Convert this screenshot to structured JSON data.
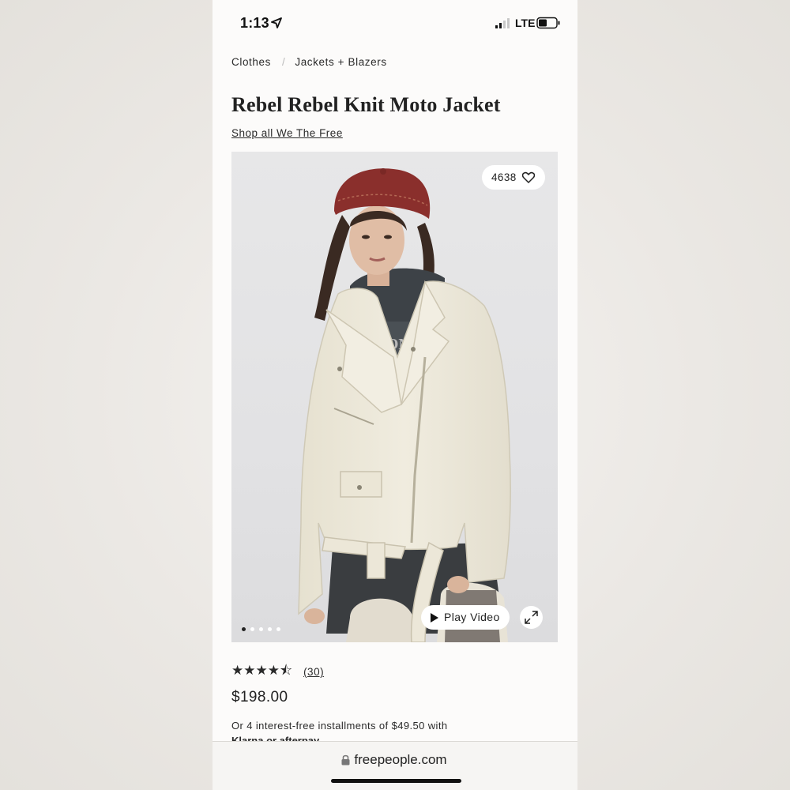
{
  "status_bar": {
    "time": "1:13",
    "network": "LTE",
    "icons": [
      "location-arrow-icon",
      "signal-icon",
      "battery-icon"
    ]
  },
  "breadcrumb": {
    "items": [
      "Clothes",
      "Jackets + Blazers"
    ],
    "separator": "/"
  },
  "product": {
    "title": "Rebel Rebel Knit Moto Jacket",
    "brand_link": "Shop all We The Free",
    "likes": "4638",
    "play_video_label": "Play Video",
    "carousel_dots": 5,
    "active_dot": 0,
    "rating": {
      "stars_value": 4.5,
      "stars_out_of": 5,
      "stars_glyphs": "★★★★⯪",
      "review_count": "(30)"
    },
    "price": "$198.00",
    "installments_text": "Or 4 interest-free installments of $49.50 with",
    "installments_providers": "Klarna or afterpay"
  },
  "browser": {
    "url": "freepeople.com"
  },
  "colors": {
    "page_bg": "#fcfbfa",
    "text": "#2a2a2a",
    "image_bg": "#e4e4e6",
    "hat": "#8a2f2c",
    "jacket": "#ece7d8"
  }
}
